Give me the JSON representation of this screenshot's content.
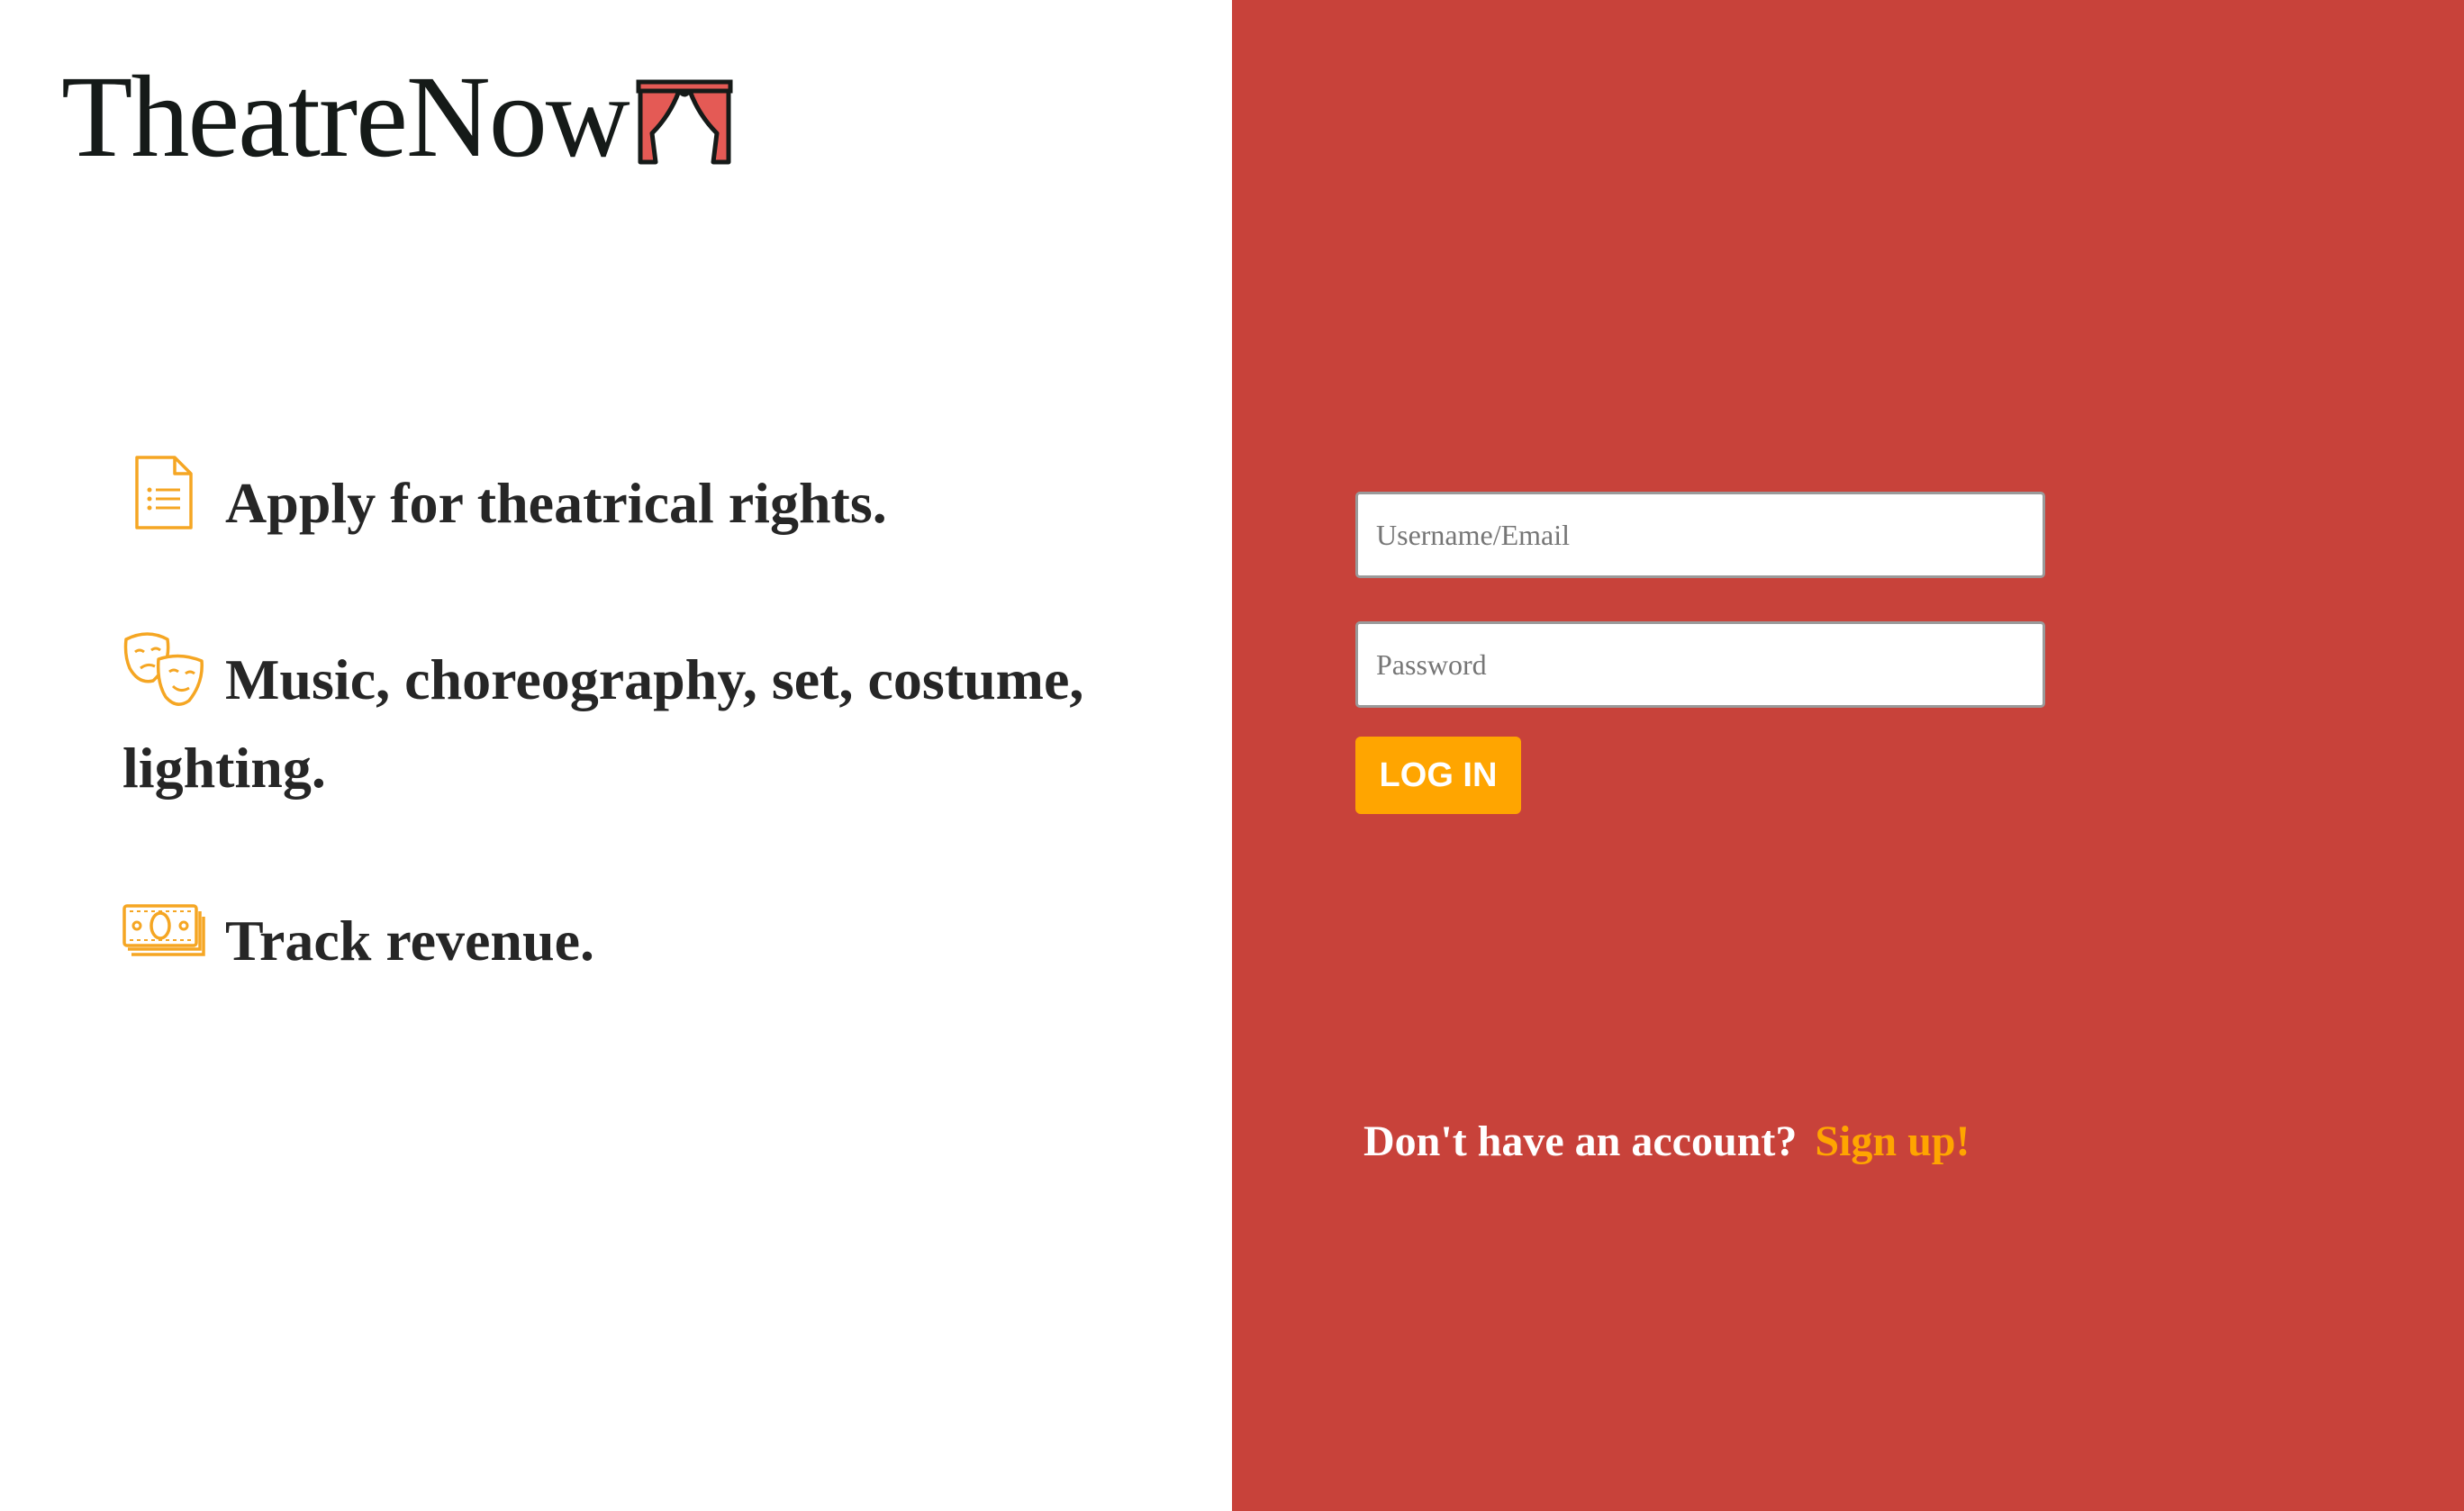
{
  "brand": {
    "name": "TheatreNow",
    "logo_icon": "theatre-curtain-icon"
  },
  "features": [
    {
      "icon": "document-list-icon",
      "text": "Apply for theatrical rights."
    },
    {
      "icon": "theatre-masks-icon",
      "text": "Music, choreography, set, costume, lighting."
    },
    {
      "icon": "money-stack-icon",
      "text": "Track revenue."
    }
  ],
  "login_form": {
    "username_placeholder": "Username/Email",
    "password_placeholder": "Password",
    "username_value": "",
    "password_value": "",
    "login_label": "LOG IN"
  },
  "signup": {
    "prompt": "Don't have an account?",
    "link_label": "Sign up!"
  },
  "colors": {
    "accent": "#ffa500",
    "panel_red": "#c8423a",
    "text_dark": "#262626",
    "curtain_red": "#e45a55"
  }
}
